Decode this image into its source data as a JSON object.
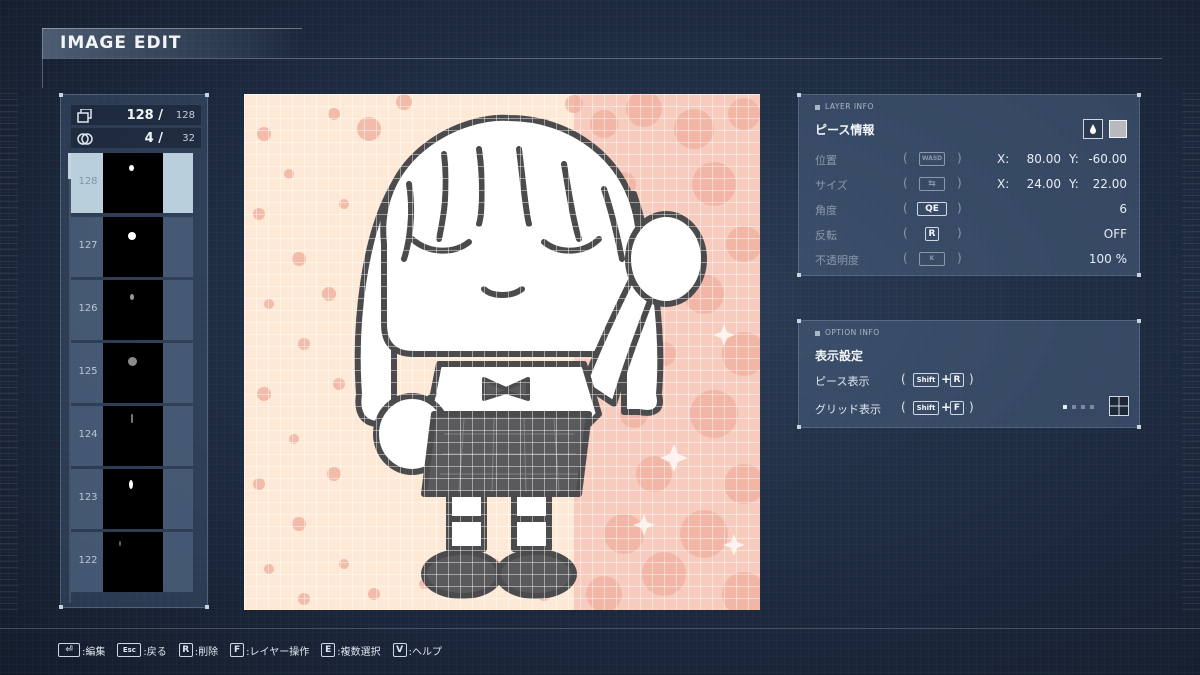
{
  "header": {
    "title": "IMAGE EDIT"
  },
  "layer_panel": {
    "piece_count": {
      "current": "128 /",
      "total": "128"
    },
    "layer_count": {
      "current": "4 /",
      "total": "32"
    },
    "items": [
      {
        "num": "128",
        "selected": true
      },
      {
        "num": "127",
        "selected": false
      },
      {
        "num": "126",
        "selected": false
      },
      {
        "num": "125",
        "selected": false
      },
      {
        "num": "124",
        "selected": false
      },
      {
        "num": "123",
        "selected": false
      },
      {
        "num": "122",
        "selected": false
      }
    ]
  },
  "layer_info": {
    "tag": "LAYER INFO",
    "title": "ピース情報",
    "rows": {
      "position": {
        "label": "位置",
        "key": "WASD",
        "x_label": "X:",
        "x": "80.00",
        "y_label": "Y:",
        "y": "-60.00"
      },
      "size": {
        "label": "サイズ",
        "key": "⇆",
        "x_label": "X:",
        "x": "24.00",
        "y_label": "Y:",
        "y": "22.00"
      },
      "angle": {
        "label": "角度",
        "key": "QE",
        "value": "6"
      },
      "flip": {
        "label": "反転",
        "key": "R",
        "value": "OFF"
      },
      "opacity": {
        "label": "不透明度",
        "key": "K",
        "value": "100 %"
      }
    },
    "swatch_color": "#b9b9bd"
  },
  "option_info": {
    "tag": "OPTION INFO",
    "title": "表示設定",
    "piece_display": {
      "label": "ピース表示",
      "key1": "Shift",
      "plus": "+",
      "key2": "R"
    },
    "grid_display": {
      "label": "グリッド表示",
      "key1": "Shift",
      "plus": "+",
      "key2": "F"
    }
  },
  "footer": {
    "items": [
      {
        "key": "⏎",
        "label": ":編集"
      },
      {
        "key": "Esc",
        "label": ":戻る"
      },
      {
        "key": "R",
        "label": ":削除"
      },
      {
        "key": "F",
        "label": ":レイヤー操作"
      },
      {
        "key": "E",
        "label": ":複数選択"
      },
      {
        "key": "V",
        "label": ":ヘルプ"
      }
    ]
  },
  "colors": {
    "canvas_bg": "#fde9d6",
    "canvas_dots": "#f2b9a6",
    "canvas_pink": "#f5c3b6",
    "figure_fill": "#ffffff",
    "figure_outline": "#4b4b4d",
    "skirt": "#5a5a5c"
  }
}
